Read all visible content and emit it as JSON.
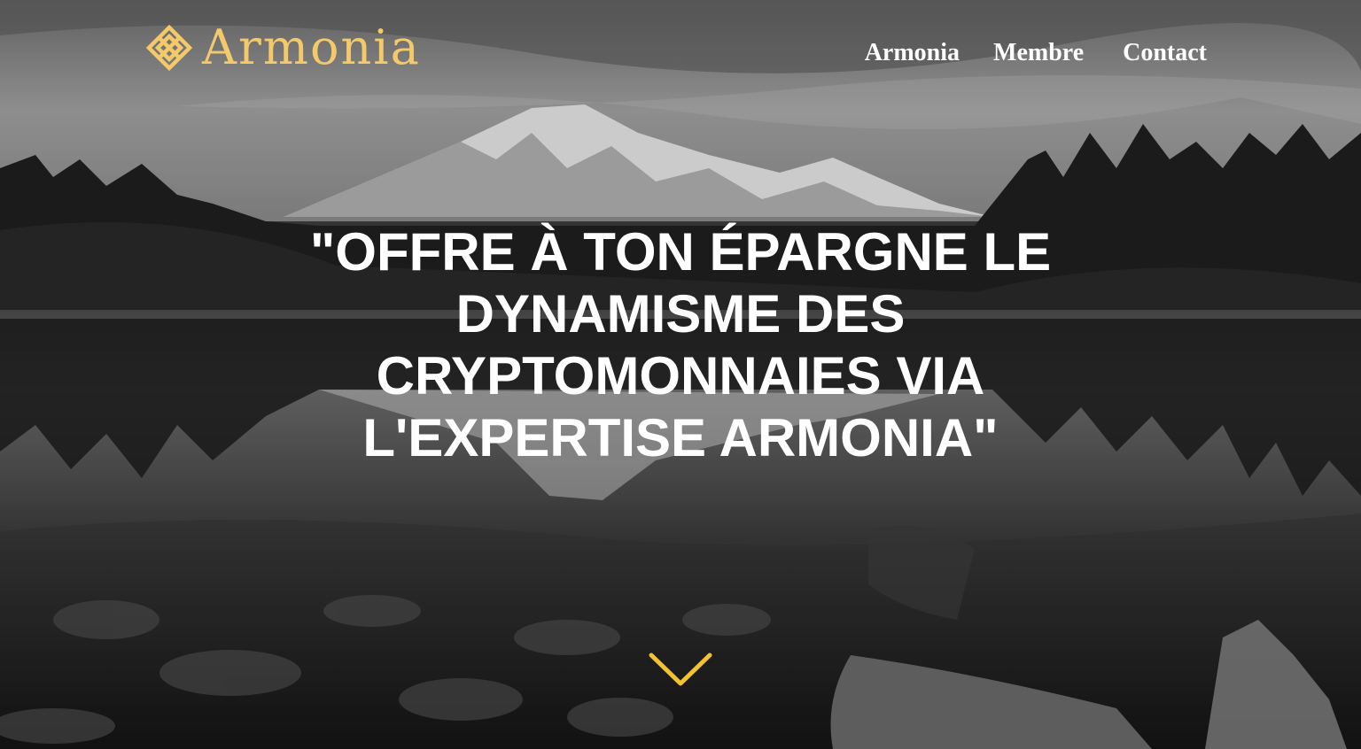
{
  "brand": {
    "name": "Armonia",
    "color": "#f4c96a",
    "logo_icon": "knot-icon"
  },
  "nav": {
    "items": [
      {
        "label": "Armonia"
      },
      {
        "label": "Membre"
      },
      {
        "label": "Contact"
      }
    ]
  },
  "hero": {
    "headline": "\"OFFRE À TON ÉPARGNE LE DYNAMISME DES CRYPTOMONNAIES VIA L'EXPERTISE ARMONIA\"",
    "scroll_icon": "chevron-down-icon",
    "accent_color": "#f1c232"
  }
}
